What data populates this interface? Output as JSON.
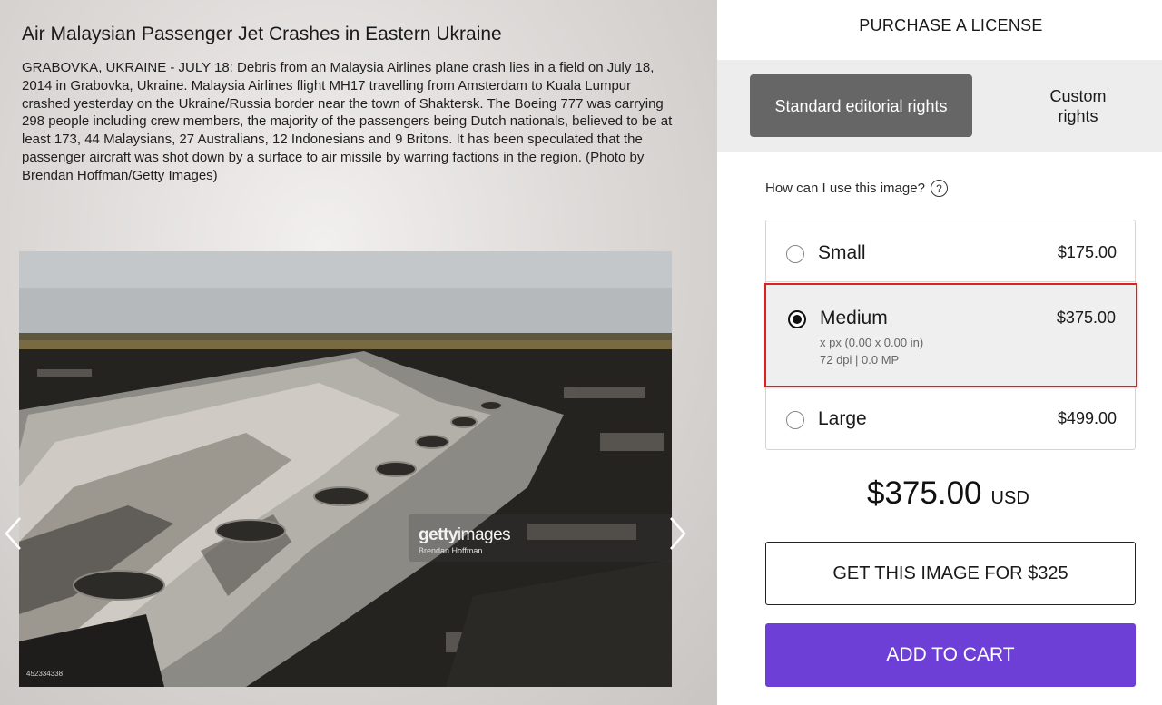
{
  "article": {
    "title": "Air Malaysian Passenger Jet Crashes in Eastern Ukraine",
    "caption": "GRABOVKA, UKRAINE - JULY 18: Debris from an Malaysia Airlines plane crash lies in a field on July 18, 2014 in Grabovka, Ukraine. Malaysia Airlines flight MH17 travelling from Amsterdam to Kuala Lumpur crashed yesterday on the Ukraine/Russia border near the town of Shaktersk. The Boeing 777 was carrying 298 people including crew members, the majority of the passengers being Dutch nationals, believed to be at least 173, 44 Malaysians, 27 Australians, 12 Indonesians and 9 Britons. It has been speculated that the passenger aircraft was shot down by a surface to air missile by warring factions in the region. (Photo by Brendan Hoffman/Getty Images)"
  },
  "photo": {
    "watermark_brand_bold": "getty",
    "watermark_brand_light": "images",
    "watermark_credit": "Brendan Hoffman",
    "image_id": "452334338",
    "prev_icon": "chevron-left-icon",
    "next_icon": "chevron-right-icon"
  },
  "license": {
    "heading": "PURCHASE A LICENSE",
    "tabs": [
      {
        "label": "Standard editorial rights",
        "active": true
      },
      {
        "label": "Custom rights",
        "active": false
      }
    ],
    "usage_question": "How can I use this image?",
    "help_icon": "?",
    "sizes": [
      {
        "name": "Small",
        "price": "$175.00",
        "selected": false
      },
      {
        "name": "Medium",
        "price": "$375.00",
        "selected": true,
        "detail_line1": "x px (0.00 x 0.00 in)",
        "detail_line2": "72 dpi | 0.0 MP"
      },
      {
        "name": "Large",
        "price": "$499.00",
        "selected": false
      }
    ],
    "total_price": "$375.00",
    "currency": "USD",
    "get_image_label": "GET THIS IMAGE FOR $325",
    "add_to_cart_label": "ADD TO CART",
    "colors": {
      "active_tab": "#666666",
      "cart_button": "#6e3fd6",
      "selected_highlight": "#e02020"
    }
  }
}
